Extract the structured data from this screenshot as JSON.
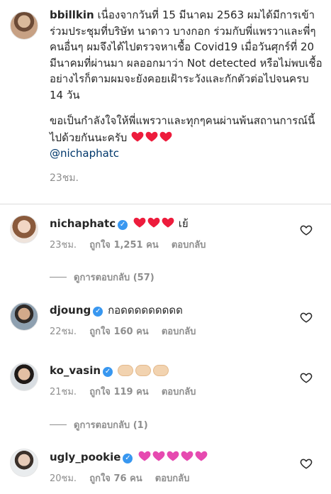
{
  "post": {
    "username": "bbillkin",
    "caption_p1": "เนื่องจากวันที่ 15 มีนาคม 2563 ผมได้มีการเข้าร่วมประชุมที่บริษัท นาดาว บางกอก ร่วมกับพี่แพรวาและพี่ๆคนอื่นๆ ผมจึงได้ไปตรวจหาเชื้อ Covid19 เมื่อวันศุกร์ที่ 20 มีนาคมที่ผ่านมา ผลออกมาว่า Not detected หรือไม่พบเชื้อ อย่างไรก็ตามผมจะยังคอยเฝ้าระวังและกักตัวต่อไปจนครบ 14 วัน",
    "caption_p2": "ขอเป็นกำลังใจให้พี่แพรวาและทุกๆคนผ่านพ้นสถานการณ์นี้ไปด้วยกันนะครับ",
    "mention": "@nichaphatc",
    "time": "23ชม."
  },
  "comments": [
    {
      "username": "nichaphatc",
      "text": "เย้",
      "time": "23ชม.",
      "likes": "ถูกใจ 1,251 คน",
      "reply": "ตอบกลับ",
      "hearts": "red"
    },
    {
      "username": "djoung",
      "text": "กอดดดดดดดดด",
      "time": "22ชม.",
      "likes": "ถูกใจ 160 คน",
      "reply": "ตอบกลับ"
    },
    {
      "username": "ko_vasin",
      "text": "",
      "time": "21ชม.",
      "likes": "ถูกใจ 119 คน",
      "reply": "ตอบกลับ",
      "icons": "clapping-hands"
    },
    {
      "username": "ugly_pookie",
      "text": "",
      "time": "20ชม.",
      "likes": "ถูกใจ 76 คน",
      "reply": "ตอบกลับ",
      "hearts": "pink"
    }
  ],
  "replies": [
    {
      "label": "ดูการตอบกลับ (57)"
    },
    {
      "label": "ดูการตอบกลับ (1)"
    }
  ],
  "colors": {
    "verified": "#3897f0",
    "link": "#00376b",
    "muted": "#8e8e8e",
    "heart_red": "#ed1c3c",
    "heart_pink": "#e64ab0"
  }
}
